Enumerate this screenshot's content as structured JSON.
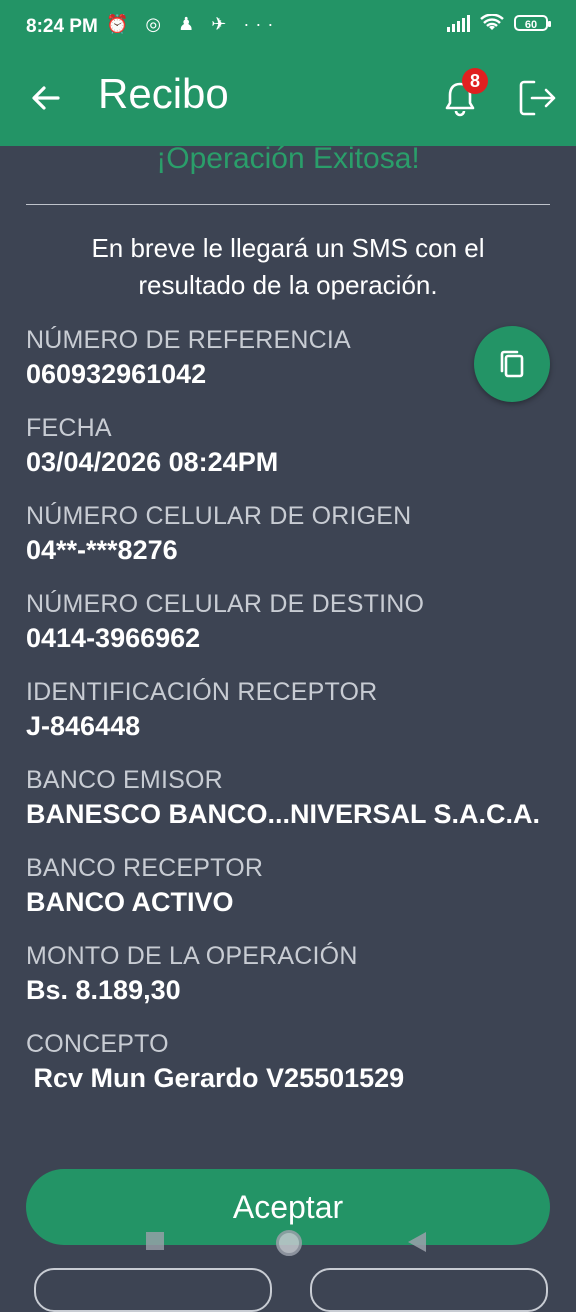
{
  "status": {
    "time": "8:24 PM",
    "left_icons": "⏰ ◎ ♟ ✈ ···",
    "battery": "60"
  },
  "header": {
    "title": "Recibo",
    "notification_count": "8"
  },
  "receipt": {
    "success_title": "¡Operación Exitosa!",
    "message": "En breve le llegará un SMS con el resultado de la operación.",
    "fields": [
      {
        "label": "NÚMERO DE REFERENCIA",
        "value": "060932961042"
      },
      {
        "label": "FECHA",
        "value": "03/04/2026 08:24PM"
      },
      {
        "label": "NÚMERO CELULAR DE ORIGEN",
        "value": "04**-***8276"
      },
      {
        "label": "NÚMERO CELULAR DE DESTINO",
        "value": "0414-3966962"
      },
      {
        "label": "IDENTIFICACIÓN RECEPTOR",
        "value": "J-846448"
      },
      {
        "label": "BANCO EMISOR",
        "value": "BANESCO BANCO...NIVERSAL S.A.C.A."
      },
      {
        "label": "BANCO RECEPTOR",
        "value": "BANCO ACTIVO"
      },
      {
        "label": "MONTO DE LA OPERACIÓN",
        "value": "Bs. 8.189,30"
      },
      {
        "label": "CONCEPTO",
        "value": " Rcv Mun Gerardo V25501529"
      }
    ]
  },
  "actions": {
    "accept_label": "Aceptar"
  },
  "icons": {
    "back": "arrow-left-icon",
    "bell": "bell-icon",
    "logout": "logout-icon",
    "copy": "copy-icon"
  },
  "colors": {
    "brand_green": "#239466",
    "background": "#3d4453",
    "success_text": "#2a9e6a",
    "badge": "#e02020"
  }
}
